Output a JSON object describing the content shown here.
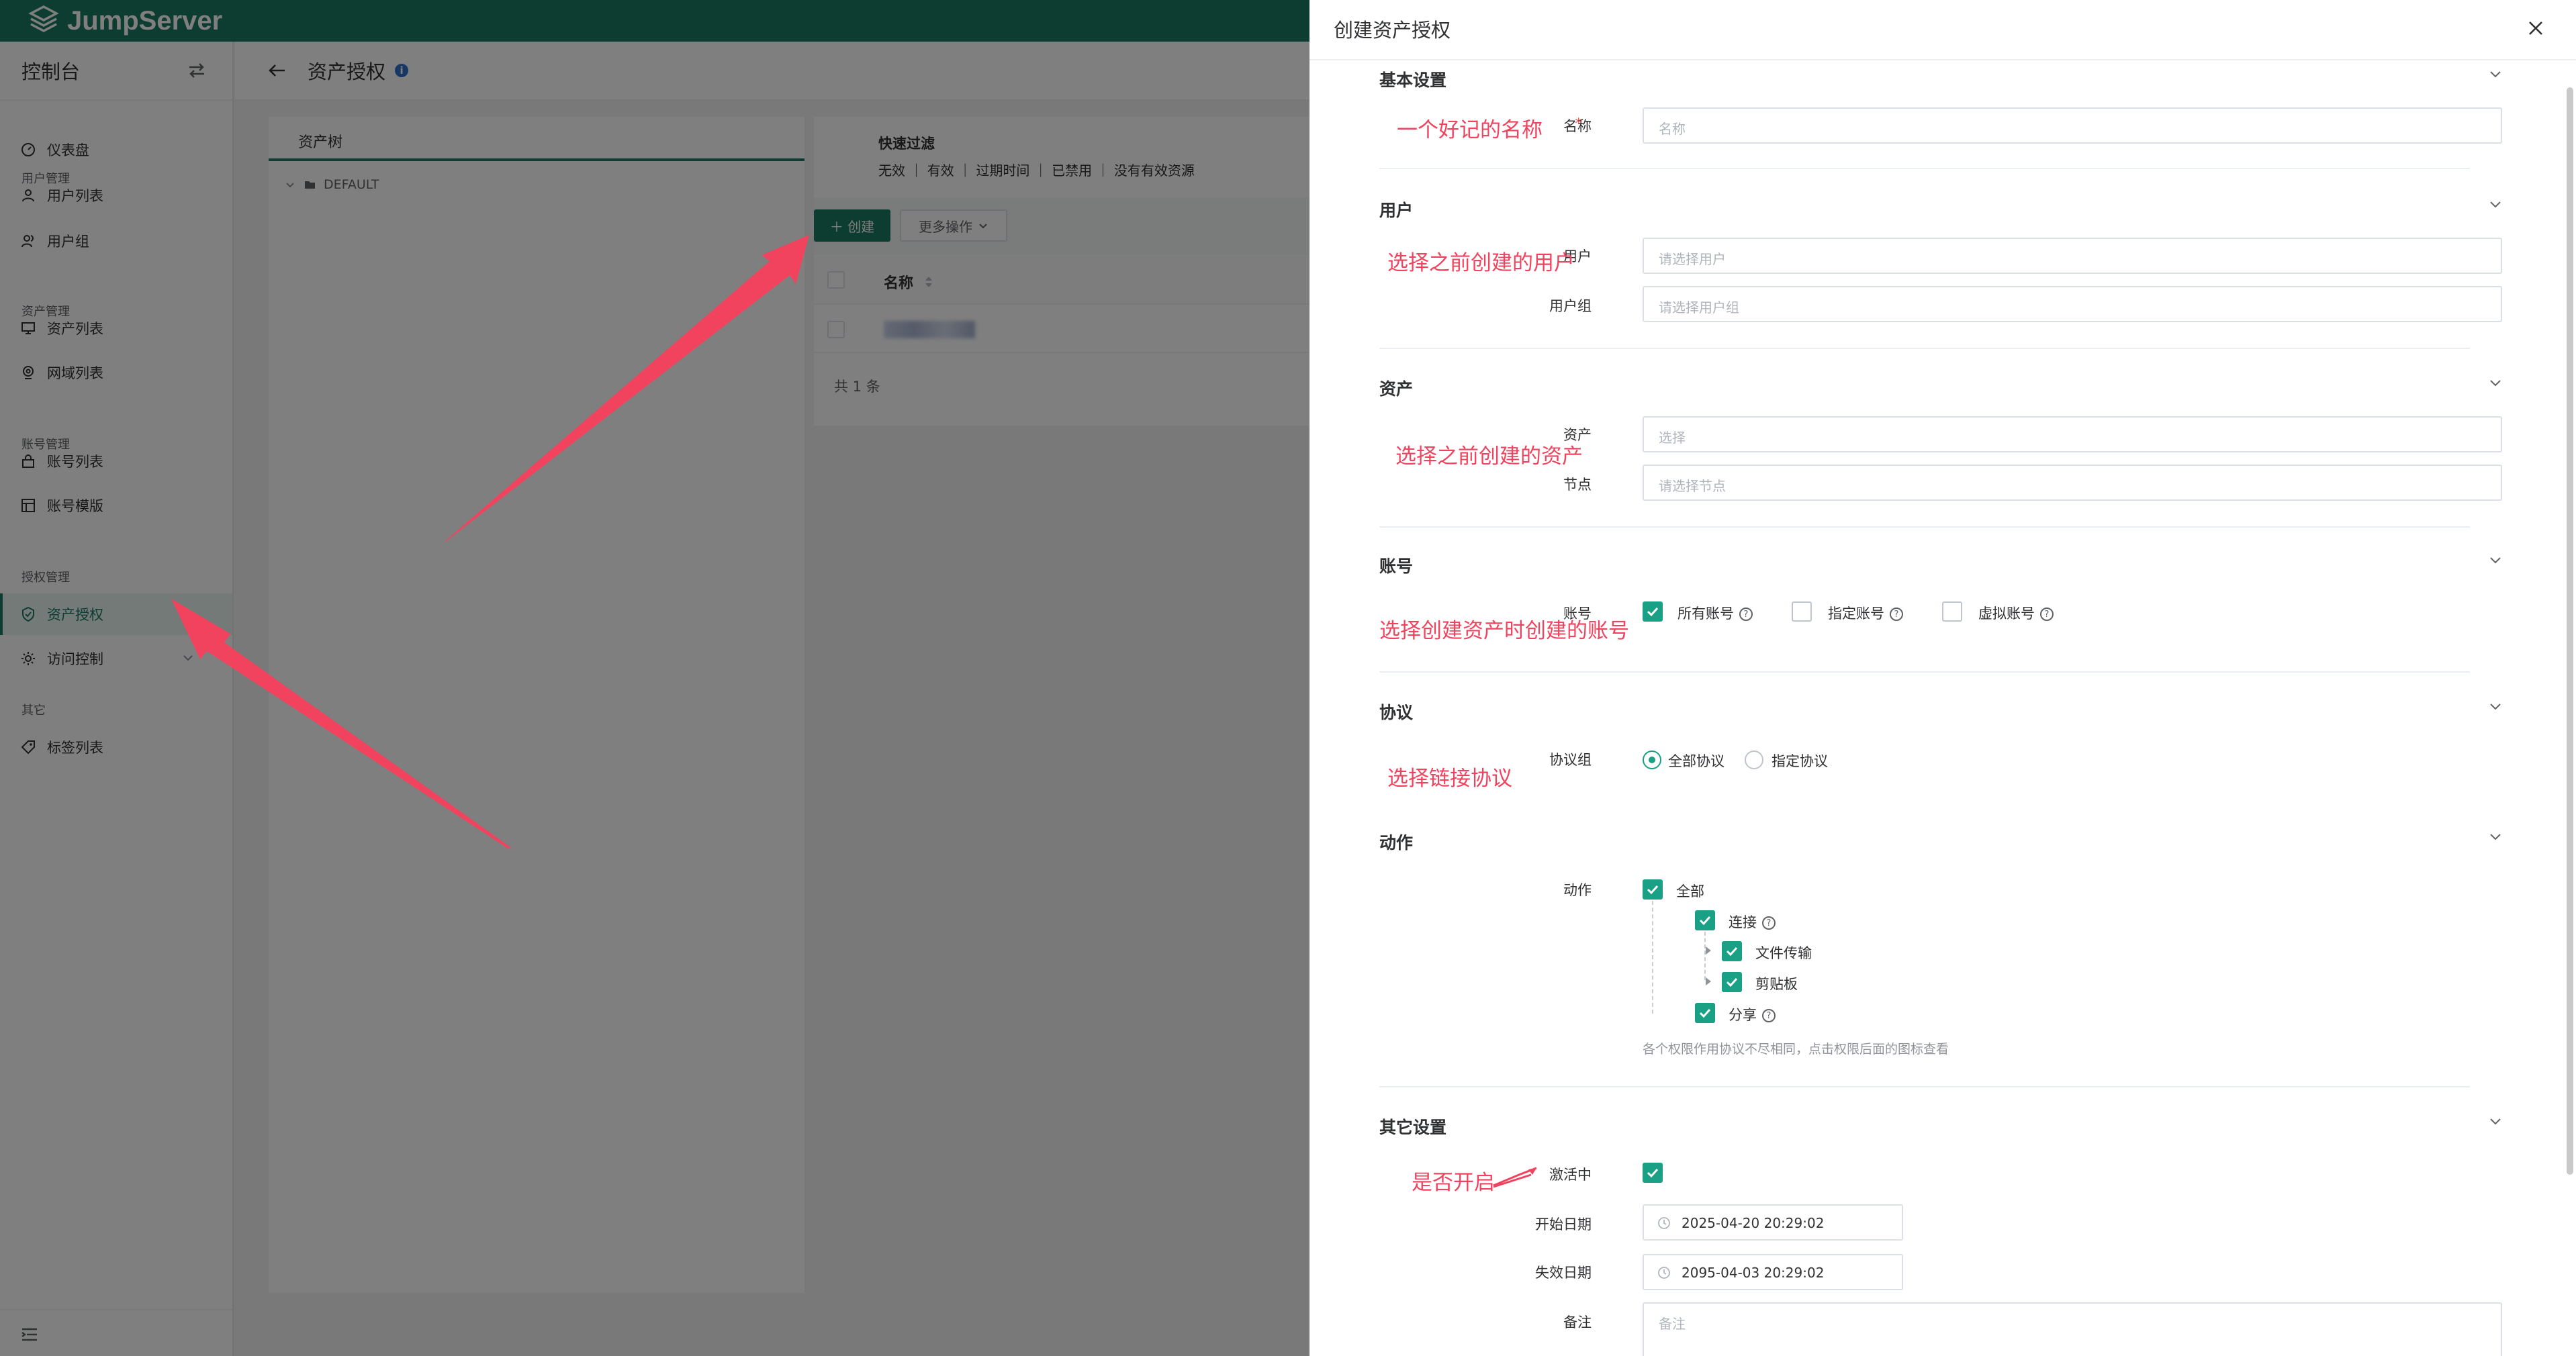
{
  "app": {
    "brand": "JumpServer"
  },
  "sidebar": {
    "title": "控制台",
    "groups": [
      "用户管理",
      "资产管理",
      "账号管理",
      "授权管理",
      "其它"
    ],
    "items": [
      "仪表盘",
      "用户列表",
      "用户组",
      "资产列表",
      "网域列表",
      "账号列表",
      "账号模版",
      "资产授权",
      "访问控制",
      "标签列表"
    ]
  },
  "page": {
    "title": "资产授权",
    "tree_tab": "资产树",
    "tree_root": "DEFAULT"
  },
  "list": {
    "quick_filter_title": "快速过滤",
    "quick_filter_items": [
      "无效",
      "有效",
      "过期时间",
      "已禁用",
      "没有有效资源"
    ],
    "create_label": "创建",
    "more_label": "更多操作",
    "column_name": "名称",
    "total": "共 1 条"
  },
  "drawer": {
    "title": "创建资产授权",
    "sections": {
      "basic": "基本设置",
      "user": "用户",
      "asset": "资产",
      "account": "账号",
      "protocol": "协议",
      "action": "动作",
      "other": "其它设置"
    },
    "fields": {
      "name": {
        "label": "名称",
        "placeholder": "名称"
      },
      "users": {
        "label": "用户",
        "placeholder": "请选择用户"
      },
      "user_groups": {
        "label": "用户组",
        "placeholder": "请选择用户组"
      },
      "assets": {
        "label": "资产",
        "placeholder": "选择"
      },
      "nodes": {
        "label": "节点",
        "placeholder": "请选择节点"
      },
      "accounts": {
        "label": "账号",
        "options": [
          {
            "label": "所有账号",
            "checked": true
          },
          {
            "label": "指定账号",
            "checked": false
          },
          {
            "label": "虚拟账号",
            "checked": false
          }
        ]
      },
      "protocols": {
        "label": "协议组",
        "options": [
          {
            "label": "全部协议",
            "selected": true
          },
          {
            "label": "指定协议",
            "selected": false
          }
        ]
      },
      "actions": {
        "label": "动作",
        "all": "全部",
        "connect": "连接",
        "transfer": "文件传输",
        "clipboard": "剪贴板",
        "share": "分享",
        "hint": "各个权限作用协议不尽相同，点击权限后面的图标查看"
      },
      "is_active": {
        "label": "激活中",
        "checked": true
      },
      "date_start": {
        "label": "开始日期",
        "value": "2025-04-20 20:29:02"
      },
      "date_expired": {
        "label": "失效日期",
        "value": "2095-04-03 20:29:02"
      },
      "comment": {
        "label": "备注",
        "placeholder": "备注"
      }
    }
  },
  "annotations": {
    "name": "一个好记的名称",
    "user": "选择之前创建的用户",
    "asset": "选择之前创建的资产",
    "account": "选择创建资产时创建的账号",
    "protocol": "选择链接协议",
    "active": "是否开启"
  },
  "colors": {
    "brand": "#1a7a61",
    "checkbox": "#1aa085",
    "annotation": "#f2435e"
  }
}
